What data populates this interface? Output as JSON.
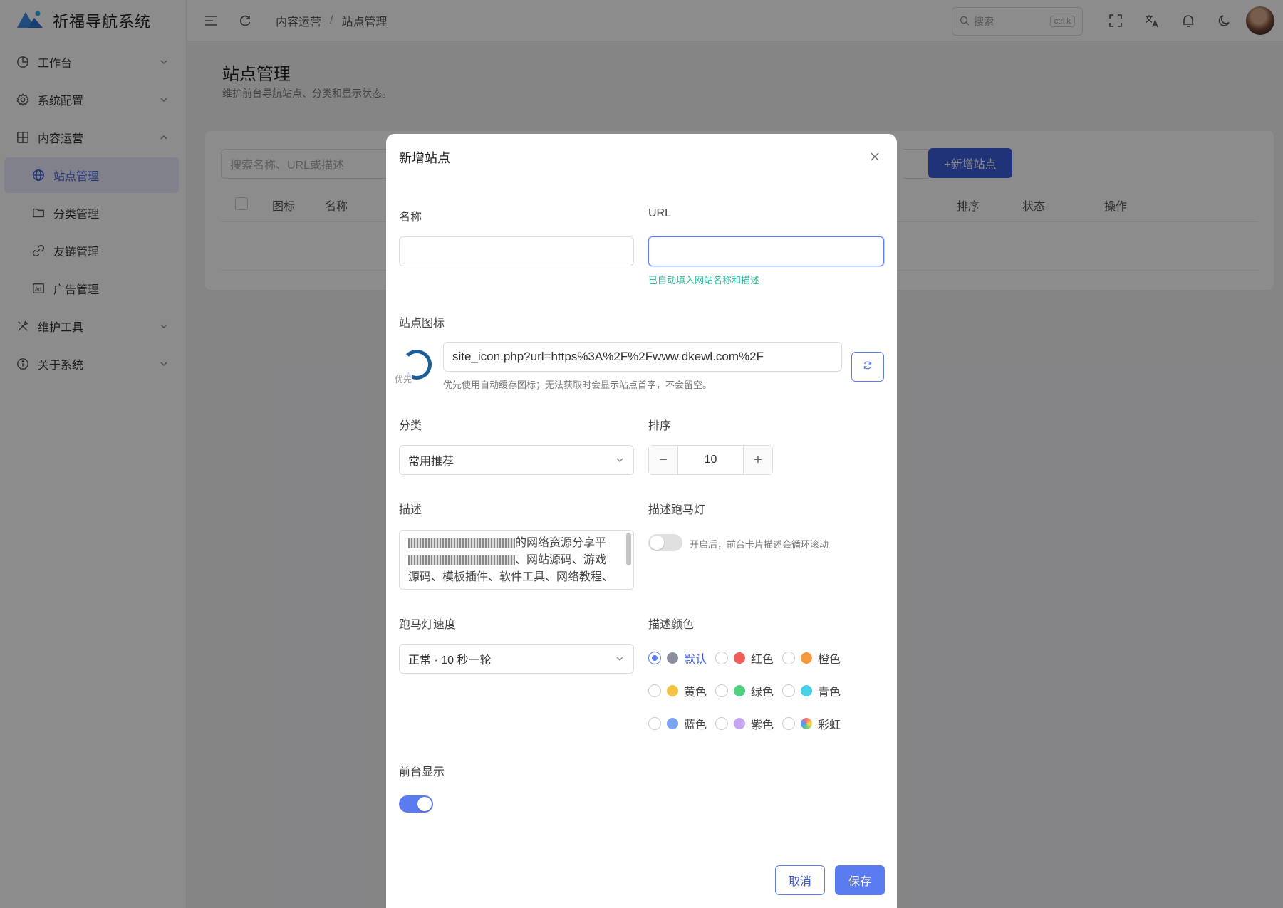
{
  "app": {
    "name": "祈福导航系统"
  },
  "sidebar": {
    "items": [
      {
        "label": "工作台",
        "icon": "dashboard-icon",
        "expanded": false
      },
      {
        "label": "系统配置",
        "icon": "gear-icon",
        "expanded": false
      },
      {
        "label": "内容运营",
        "icon": "grid-icon",
        "expanded": true
      },
      {
        "label": "站点管理",
        "icon": "globe-icon",
        "active": true
      },
      {
        "label": "分类管理",
        "icon": "folder-icon"
      },
      {
        "label": "友链管理",
        "icon": "link-icon"
      },
      {
        "label": "广告管理",
        "icon": "ad-icon"
      },
      {
        "label": "维护工具",
        "icon": "tools-icon",
        "expanded": false
      },
      {
        "label": "关于系统",
        "icon": "info-icon",
        "expanded": false
      }
    ]
  },
  "header": {
    "breadcrumb": [
      "内容运营",
      "站点管理"
    ],
    "breadcrumb_sep": "/",
    "search_placeholder": "搜索",
    "search_shortcut": "ctrl k"
  },
  "page": {
    "title": "站点管理",
    "subtitle": "维护前台导航站点、分类和显示状态。",
    "search_placeholder": "搜索名称、URL或描述",
    "new_button": "+新增站点",
    "columns": [
      "图标",
      "名称",
      "排序",
      "状态",
      "操作"
    ]
  },
  "modal": {
    "title": "新增站点",
    "name_label": "名称",
    "name_value": "",
    "url_label": "URL",
    "url_value": "",
    "url_hint": "已自动填入网站名称和描述",
    "icon_label": "站点图标",
    "icon_caption": "优先",
    "icon_value": "site_icon.php?url=https%3A%2F%2Fwww.dkewl.com%2F",
    "icon_hint": "优先使用自动缓存图标；无法获取时会显示站点首字，不会留空。",
    "category_label": "分类",
    "category_value": "常用推荐",
    "sort_label": "排序",
    "sort_value": "10",
    "desc_label": "描述",
    "desc_line1": "的网络资源分享平",
    "desc_line2": "、网站源码、游戏",
    "desc_line3": "源码、模板插件、软件工具、网络教程、",
    "marquee_label": "描述跑马灯",
    "marquee_enabled": false,
    "marquee_hint": "开启后，前台卡片描述会循环滚动",
    "speed_label": "跑马灯速度",
    "speed_value": "正常 · 10 秒一轮",
    "color_label": "描述颜色",
    "colors": [
      {
        "label": "默认",
        "hex": "#8a8f9c",
        "selected": true
      },
      {
        "label": "红色",
        "hex": "#ef5b5b"
      },
      {
        "label": "橙色",
        "hex": "#f59a3c"
      },
      {
        "label": "黄色",
        "hex": "#f5c344"
      },
      {
        "label": "绿色",
        "hex": "#4fd17f"
      },
      {
        "label": "青色",
        "hex": "#47d1e8"
      },
      {
        "label": "蓝色",
        "hex": "#7ba4f2"
      },
      {
        "label": "紫色",
        "hex": "#c4a5f0"
      },
      {
        "label": "彩虹",
        "hex": "conic-gradient(#ff6b6b,#ffd93d,#6bcB77,#4d96ff,#ff6b6b)"
      }
    ],
    "frontend_label": "前台显示",
    "frontend_enabled": true,
    "cancel_label": "取消",
    "save_label": "保存"
  },
  "colors": {
    "accent": "#5b7cf0",
    "brand": "#3b5bdb",
    "success_hint": "#2bb89a"
  }
}
